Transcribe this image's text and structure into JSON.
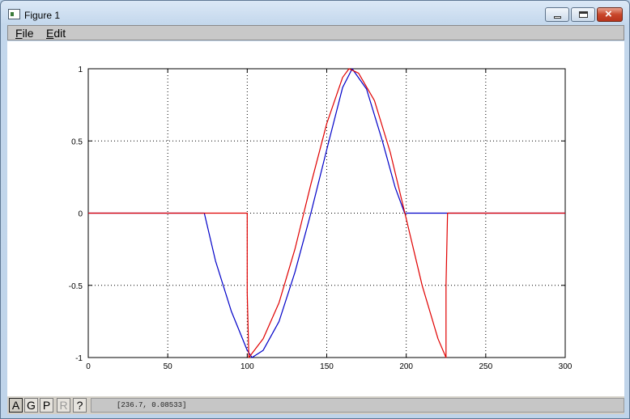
{
  "window": {
    "title": "Figure 1"
  },
  "menu": {
    "items": [
      {
        "key": "F",
        "rest": "ile"
      },
      {
        "key": "E",
        "rest": "dit"
      }
    ]
  },
  "toolbar": {
    "buttons": [
      "A",
      "G",
      "P",
      "R",
      "?"
    ],
    "active": "A",
    "disabled": "R"
  },
  "status": {
    "coords": "[236.7, 0.08533]"
  },
  "chart_data": {
    "type": "line",
    "title": "",
    "xlabel": "",
    "ylabel": "",
    "xlim": [
      0,
      300
    ],
    "ylim": [
      -1,
      1
    ],
    "grid": true,
    "xticks": [
      0,
      50,
      100,
      150,
      200,
      250,
      300
    ],
    "xtick_labels": [
      "0",
      "50",
      "100",
      "150",
      "200",
      "250",
      "300"
    ],
    "yticks": [
      -1,
      -0.5,
      0,
      0.5,
      1
    ],
    "ytick_labels": [
      "-1",
      "-0.5",
      "0",
      "0.5",
      "1"
    ],
    "series": [
      {
        "color": "#0000c8",
        "x": [
          0,
          73,
          80,
          90,
          100,
          103,
          110,
          120,
          130,
          140,
          150,
          160,
          166,
          175,
          185,
          193,
          199,
          200,
          240,
          300
        ],
        "y": [
          0,
          0,
          -0.33,
          -0.68,
          -0.95,
          -1,
          -0.95,
          -0.75,
          -0.41,
          0,
          0.44,
          0.87,
          1,
          0.86,
          0.5,
          0.18,
          0,
          0,
          0,
          0
        ]
      },
      {
        "color": "#e00000",
        "x": [
          0,
          72,
          100,
          100,
          101,
          110,
          120,
          130,
          140,
          150,
          160,
          164,
          170,
          180,
          190,
          200,
          210,
          220,
          225,
          225,
          226,
          300
        ],
        "y": [
          0,
          0,
          0,
          -0.55,
          -1,
          -0.87,
          -0.62,
          -0.25,
          0.2,
          0.62,
          0.94,
          1,
          0.97,
          0.78,
          0.42,
          -0.04,
          -0.5,
          -0.87,
          -1,
          -0.5,
          0,
          0
        ]
      }
    ]
  }
}
